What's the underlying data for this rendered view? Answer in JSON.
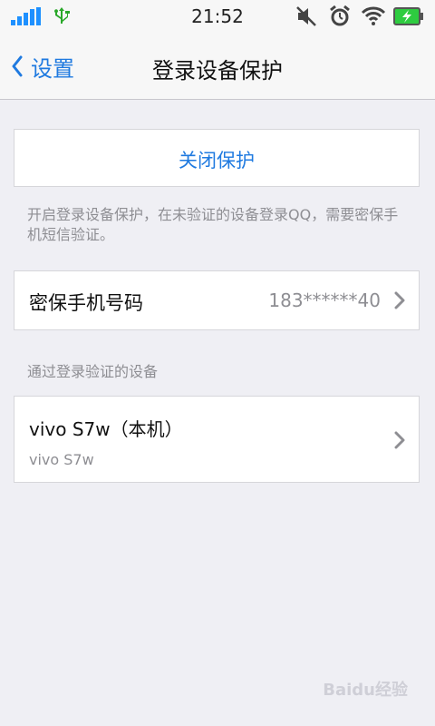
{
  "status_bar": {
    "time": "21:52",
    "icons": [
      "signal-icon",
      "usb-icon",
      "mute-icon",
      "alarm-icon",
      "wifi-icon",
      "battery-charging-icon"
    ]
  },
  "nav": {
    "back_label": "设置",
    "title": "登录设备保护"
  },
  "protection": {
    "close_label": "关闭保护",
    "note": "开启登录设备保护，在未验证的设备登录QQ，需要密保手机短信验证。"
  },
  "phone": {
    "label": "密保手机号码",
    "value": "183******40"
  },
  "devices": {
    "header": "通过登录验证的设备",
    "items": [
      {
        "name": "vivo S7w（本机）",
        "model": "vivo S7w"
      }
    ]
  },
  "watermark": "Baidu经验",
  "colors": {
    "accent": "#1f7ae0",
    "background": "#efeff4",
    "secondary_text": "#8e8e93",
    "battery_green": "#2ecc40"
  }
}
